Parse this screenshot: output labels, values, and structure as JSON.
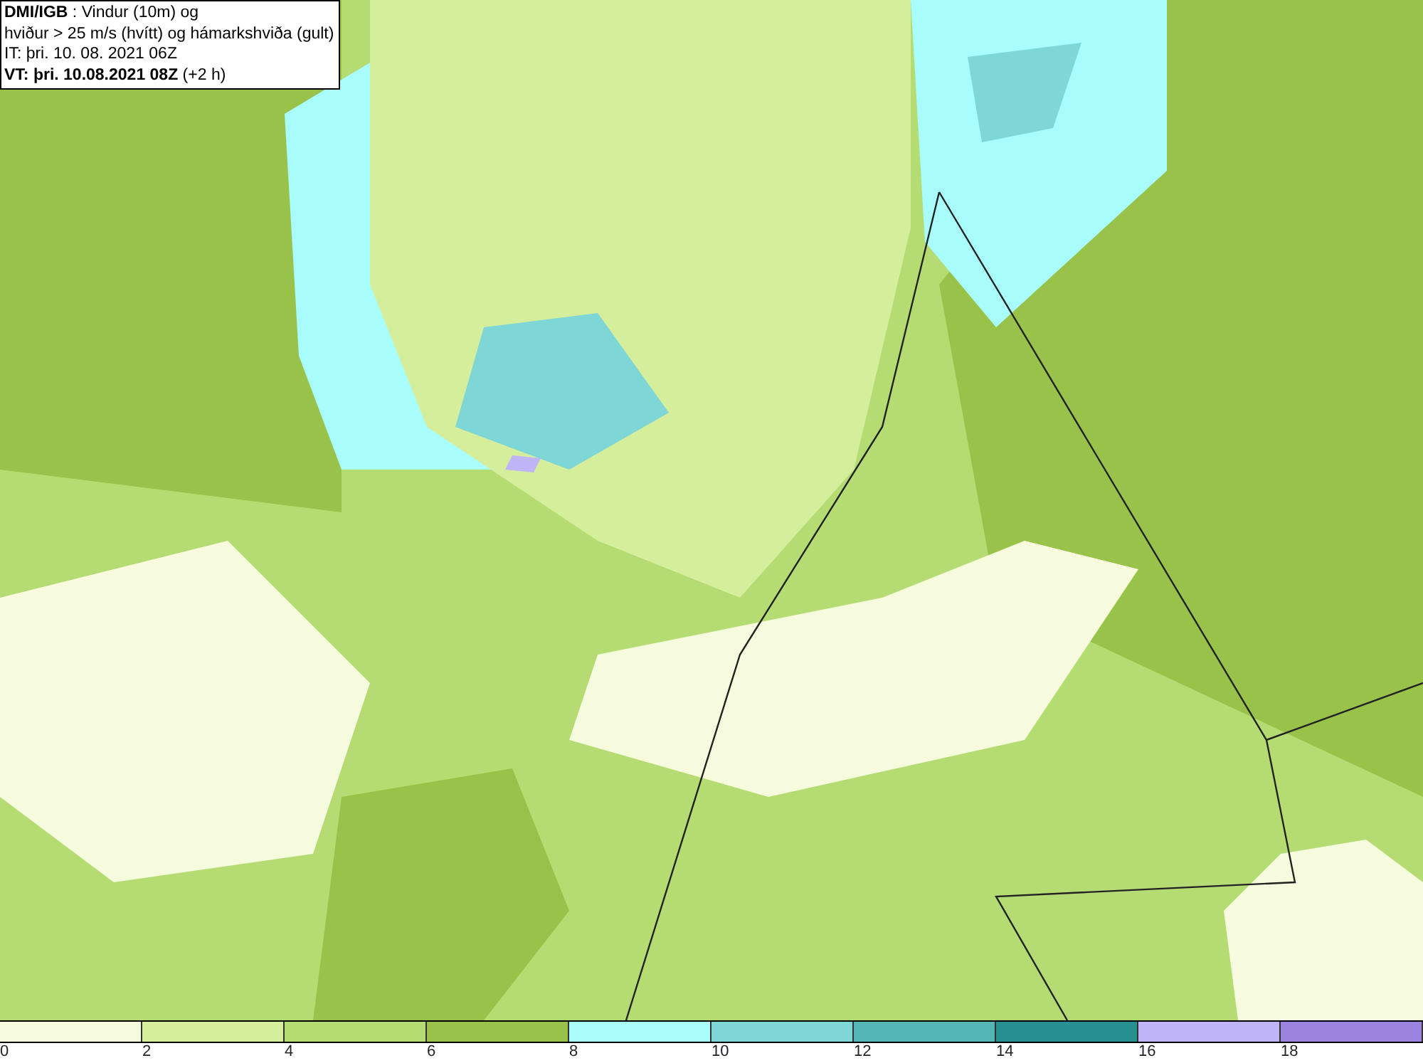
{
  "info_box": {
    "lines": [
      "**DMI/IGB** : Vindur (10m) og",
      "hviður > 25 m/s (hvítt) og hámarkshviða (gult)",
      "IT: þri. 10. 08. 2021 06Z",
      "**VT: þri. 10.08.2021 08Z** (+2 h)"
    ]
  },
  "color_scale": {
    "bins": [
      {
        "color": "#f5fbdc"
      },
      {
        "color": "#d5ee9c"
      },
      {
        "color": "#b5dc72"
      },
      {
        "color": "#99c24a"
      },
      {
        "color": "#a8fcfc"
      },
      {
        "color": "#7ed6d6"
      },
      {
        "color": "#55b4b4"
      },
      {
        "color": "#279090"
      },
      {
        "color": "#c0b4f8"
      },
      {
        "color": "#9a84e0"
      }
    ],
    "ticks": [
      "0",
      "2",
      "4",
      "6",
      "8",
      "10",
      "12",
      "14",
      "16",
      "18"
    ]
  }
}
